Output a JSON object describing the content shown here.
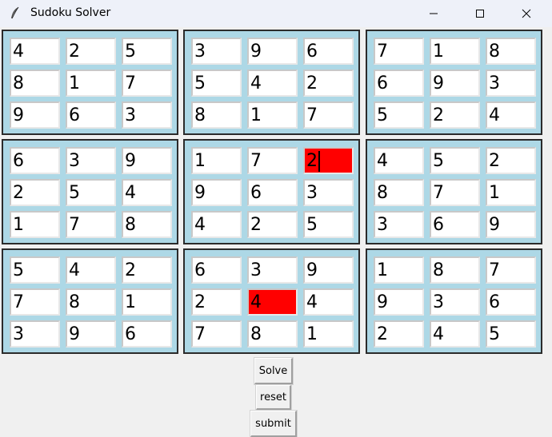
{
  "window": {
    "title": "Sudoku Solver",
    "controls": [
      "minimize",
      "maximize",
      "close"
    ]
  },
  "grid": {
    "highlight_color": "#ff0000",
    "box_color": "#add8e6",
    "rows": [
      [
        "4",
        "2",
        "5",
        "3",
        "9",
        "6",
        "7",
        "1",
        "8"
      ],
      [
        "8",
        "1",
        "7",
        "5",
        "4",
        "2",
        "6",
        "9",
        "3"
      ],
      [
        "9",
        "6",
        "3",
        "8",
        "1",
        "7",
        "5",
        "2",
        "4"
      ],
      [
        "6",
        "3",
        "9",
        "1",
        "7",
        "2",
        "4",
        "5",
        "2"
      ],
      [
        "2",
        "5",
        "4",
        "9",
        "6",
        "3",
        "8",
        "7",
        "1"
      ],
      [
        "1",
        "7",
        "8",
        "4",
        "2",
        "5",
        "3",
        "6",
        "9"
      ],
      [
        "5",
        "4",
        "2",
        "6",
        "3",
        "9",
        "1",
        "8",
        "7"
      ],
      [
        "7",
        "8",
        "1",
        "2",
        "4",
        "4",
        "9",
        "3",
        "6"
      ],
      [
        "3",
        "9",
        "6",
        "7",
        "8",
        "1",
        "2",
        "4",
        "5"
      ]
    ],
    "highlighted_cells": [
      [
        3,
        5
      ],
      [
        7,
        4
      ]
    ],
    "focused_cell": [
      3,
      5
    ]
  },
  "buttons": {
    "solve": "Solve",
    "reset": "reset",
    "submit": "submit"
  }
}
